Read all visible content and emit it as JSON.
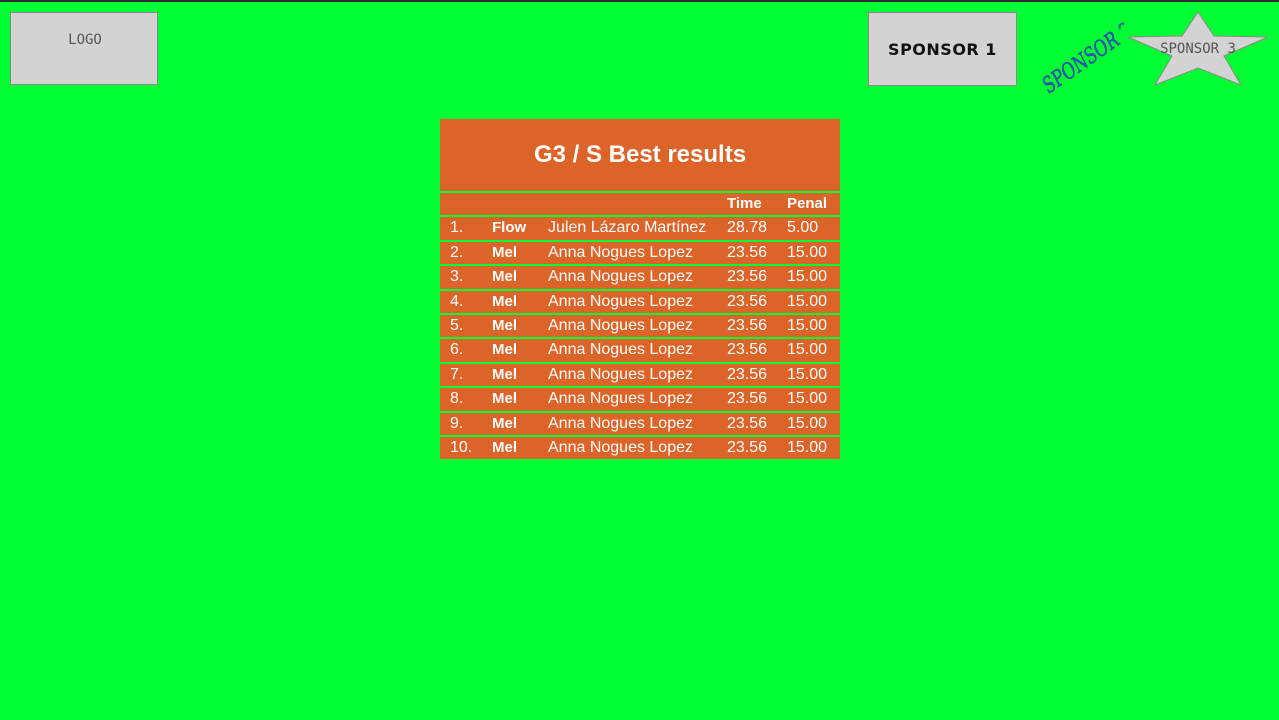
{
  "logo": {
    "label": "LOGO"
  },
  "sponsors": {
    "sponsor1": "SPONSOR 1",
    "sponsor2": "SPONSOR 2",
    "sponsor3": "SPONSOR 3"
  },
  "results": {
    "title": "G3 / S Best results",
    "headers": {
      "time": "Time",
      "penalty": "Penal"
    },
    "rows": [
      {
        "rank": "1.",
        "club": "Flow",
        "name": "Julen Lázaro Martínez",
        "time": "28.78",
        "penalty": "5.00"
      },
      {
        "rank": "2.",
        "club": "Mel",
        "name": "Anna Nogues Lopez",
        "time": "23.56",
        "penalty": "15.00"
      },
      {
        "rank": "3.",
        "club": "Mel",
        "name": "Anna Nogues Lopez",
        "time": "23.56",
        "penalty": "15.00"
      },
      {
        "rank": "4.",
        "club": "Mel",
        "name": "Anna Nogues Lopez",
        "time": "23.56",
        "penalty": "15.00"
      },
      {
        "rank": "5.",
        "club": "Mel",
        "name": "Anna Nogues Lopez",
        "time": "23.56",
        "penalty": "15.00"
      },
      {
        "rank": "6.",
        "club": "Mel",
        "name": "Anna Nogues Lopez",
        "time": "23.56",
        "penalty": "15.00"
      },
      {
        "rank": "7.",
        "club": "Mel",
        "name": "Anna Nogues Lopez",
        "time": "23.56",
        "penalty": "15.00"
      },
      {
        "rank": "8.",
        "club": "Mel",
        "name": "Anna Nogues Lopez",
        "time": "23.56",
        "penalty": "15.00"
      },
      {
        "rank": "9.",
        "club": "Mel",
        "name": "Anna Nogues Lopez",
        "time": "23.56",
        "penalty": "15.00"
      },
      {
        "rank": "10.",
        "club": "Mel",
        "name": "Anna Nogues Lopez",
        "time": "23.56",
        "penalty": "15.00"
      }
    ]
  },
  "colors": {
    "background": "#00ff33",
    "panel": "#dc6428",
    "text": "#ffffff",
    "sponsor2_text": "#3355cc"
  }
}
